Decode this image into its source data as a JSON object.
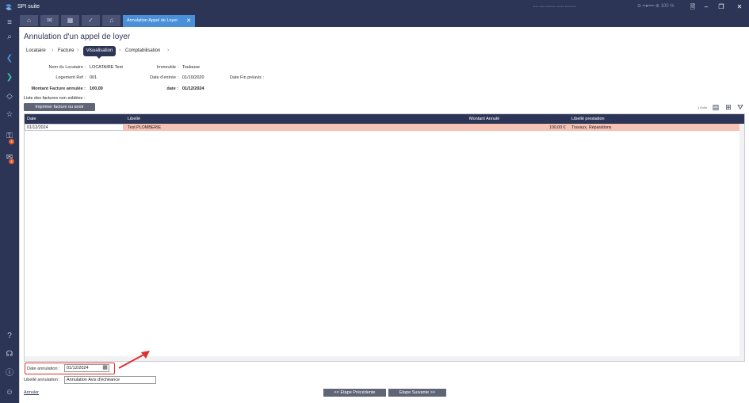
{
  "app": {
    "name": "SPI suite",
    "blurred_info": "•••• •••• •••••••   ••••• ••••••••",
    "zoom": "100 %"
  },
  "tabs": {
    "active": "Annulation Appel de Loyer"
  },
  "sidebar": {
    "badge_1": "4",
    "badge_2": "4"
  },
  "page": {
    "title": "Annulation d'un appel de loyer"
  },
  "steps": [
    "Locataire",
    "Facture",
    "Visualisation",
    "Comptabilisation"
  ],
  "info": {
    "nom_label": "Nom du Locataire :",
    "nom_value": "LOCATAIRE Test",
    "immeuble_label": "Immeuble :",
    "immeuble_value": "Toulouse",
    "logement_label": "Logement Ref :",
    "logement_value": "001",
    "entree_label": "Date d'entrée :",
    "entree_value": "01/10/2020",
    "preavis_label": "Date Fin préavis :",
    "preavis_value": "",
    "montant_label": "Montant Facture annulée :",
    "montant_value": "100,00",
    "date_label": "date :",
    "date_value": "01/12/2024",
    "list_label": "Liste des factures non soldées :"
  },
  "print_button": "Imprimer facture ou avoir",
  "grid": {
    "count": "1 Ecl/e",
    "columns": [
      "Date",
      "Libellé",
      "Montant Annulé",
      "Libellé prestation"
    ],
    "rows": [
      {
        "date": "01/12/2024",
        "libelle": "Test PLOMBERIE",
        "montant": "100,00 €",
        "prestation": "Travaux, Réparations"
      }
    ]
  },
  "form": {
    "date_label": "Date annulation :",
    "date_value": "01/12/2024",
    "libelle_label": "Libellé annulation :",
    "libelle_value": "Annulation Avis d'échéance"
  },
  "actions": {
    "cancel": "Annuler",
    "prev": "<< Etape Précédente",
    "next": "Etape Suivante >>"
  },
  "colors": {
    "navy": "#2c3556",
    "accent": "#4a90d9",
    "row_highlight": "#f6c2b4",
    "annotation_red": "#e03030"
  }
}
